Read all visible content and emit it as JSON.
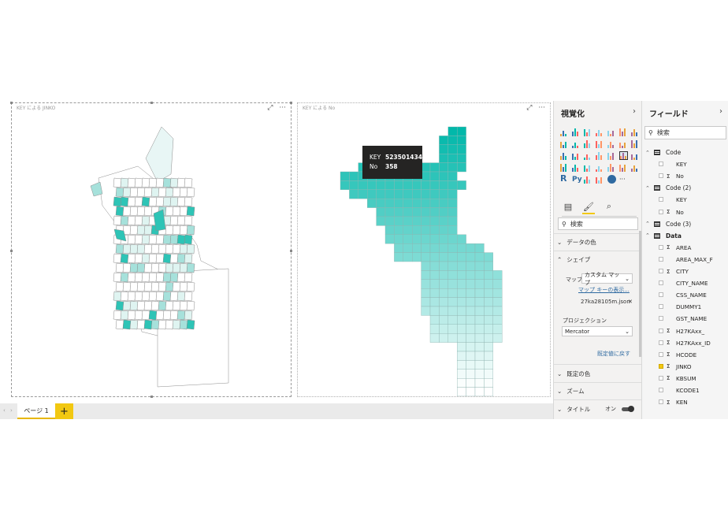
{
  "visual1": {
    "title": "KEY による JINKO"
  },
  "visual2": {
    "title": "KEY による No",
    "tooltip": {
      "k1": "KEY",
      "v1": "5235014342",
      "k2": "No",
      "v2": "358"
    }
  },
  "pages": {
    "tab_label": "ページ 1",
    "add_label": "+"
  },
  "viz_pane": {
    "title": "視覚化",
    "search_placeholder": "検索",
    "data_colors": "データの色",
    "shape": "シェイプ",
    "map_label": "マップ",
    "map_value": "カスタム マップ",
    "map_key_link": "マップ キーの表示...",
    "file_name": "27ka28105m.json",
    "projection_label": "プロジェクション",
    "projection_value": "Mercator",
    "reset_link": "既定値に戻す",
    "default_colors": "既定の色",
    "zoom": "ズーム",
    "title_section": "タイトル",
    "title_toggle": "オン"
  },
  "fields_pane": {
    "title": "フィールド",
    "search_placeholder": "検索",
    "rows": [
      {
        "kind": "table",
        "name": "Code"
      },
      {
        "kind": "field",
        "name": "KEY",
        "sigma": ""
      },
      {
        "kind": "field",
        "name": "No",
        "sigma": "Σ"
      },
      {
        "kind": "table",
        "name": "Code (2)"
      },
      {
        "kind": "field",
        "name": "KEY",
        "sigma": ""
      },
      {
        "kind": "field",
        "name": "No",
        "sigma": "Σ"
      },
      {
        "kind": "table",
        "name": "Code (3)"
      },
      {
        "kind": "table",
        "name": "Data",
        "bold": true
      },
      {
        "kind": "field",
        "name": "AREA",
        "sigma": "Σ"
      },
      {
        "kind": "field",
        "name": "AREA_MAX_F",
        "sigma": ""
      },
      {
        "kind": "field",
        "name": "CITY",
        "sigma": "Σ"
      },
      {
        "kind": "field",
        "name": "CITY_NAME",
        "sigma": ""
      },
      {
        "kind": "field",
        "name": "CSS_NAME",
        "sigma": ""
      },
      {
        "kind": "field",
        "name": "DUMMY1",
        "sigma": ""
      },
      {
        "kind": "field",
        "name": "GST_NAME",
        "sigma": ""
      },
      {
        "kind": "field",
        "name": "H27KAxx_",
        "sigma": "Σ"
      },
      {
        "kind": "field",
        "name": "H27KAxx_ID",
        "sigma": "Σ"
      },
      {
        "kind": "field",
        "name": "HCODE",
        "sigma": "Σ"
      },
      {
        "kind": "field",
        "name": "JINKO",
        "sigma": "Σ",
        "checked": true
      },
      {
        "kind": "field",
        "name": "KBSUM",
        "sigma": "Σ"
      },
      {
        "kind": "field",
        "name": "KCODE1",
        "sigma": ""
      },
      {
        "kind": "field",
        "name": "KEN",
        "sigma": "Σ"
      }
    ]
  },
  "colors": {
    "accent": "#f2c811",
    "teal": "#01b8aa"
  },
  "icons": {
    "more": "more-options-icon",
    "focus": "focus-mode-icon"
  }
}
